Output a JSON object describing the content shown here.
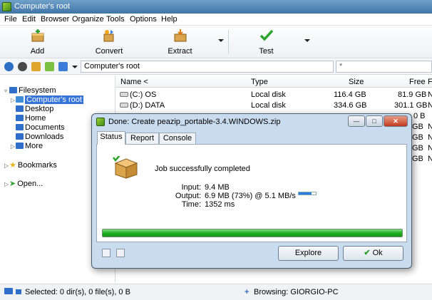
{
  "window": {
    "title": "Computer's root"
  },
  "menu": [
    "File",
    "Edit",
    "Browser",
    "Organize",
    "Tools",
    "Options",
    "Help"
  ],
  "toolbar": {
    "add": "Add",
    "convert": "Convert",
    "extract": "Extract",
    "test": "Test"
  },
  "address": {
    "path": "Computer's root",
    "filter": "*"
  },
  "tree": {
    "root": "Filesystem",
    "selected": "Computer's root",
    "children": [
      "Desktop",
      "Home",
      "Documents",
      "Downloads",
      "More"
    ],
    "bookmarks": "Bookmarks",
    "open": "Open..."
  },
  "list": {
    "columns": {
      "name": "Name <",
      "type": "Type",
      "size": "Size",
      "free": "Free",
      "extra": "F"
    },
    "rows": [
      {
        "name": "(C:) OS",
        "type": "Local disk",
        "size": "116.4 GB",
        "free": "81.9 GB",
        "flag": "N"
      },
      {
        "name": "(D:) DATA",
        "type": "Local disk",
        "size": "334.6 GB",
        "free": "301.1 GB",
        "flag": "N"
      }
    ],
    "partial_free": [
      "0 B",
      "GB",
      "GB",
      "GB",
      "GB"
    ],
    "partial_flag": [
      "N",
      "N",
      "N",
      "N"
    ]
  },
  "status": {
    "selected": "Selected: 0 dir(s), 0 file(s), 0 B",
    "browsing": "Browsing: GIORGIO-PC"
  },
  "dialog": {
    "title": "Done: Create peazip_portable-3.4.WINDOWS.zip",
    "tabs": [
      "Status",
      "Report",
      "Console"
    ],
    "message": "Job successfully completed",
    "input_label": "Input:",
    "input_value": "9.4 MB",
    "output_label": "Output:",
    "output_value": "6.9 MB (73%) @ 5.1 MB/s",
    "time_label": "Time:",
    "time_value": "1352 ms",
    "progress": 1.0,
    "output_ratio": 0.73,
    "explore": "Explore",
    "ok": "Ok",
    "min": "—",
    "max": "□",
    "close": "✕"
  }
}
